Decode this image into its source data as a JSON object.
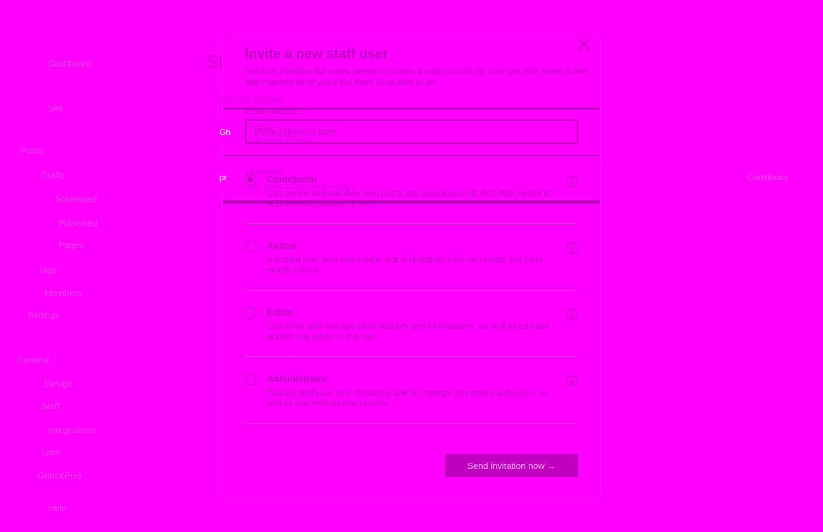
{
  "background": {
    "sidebar_items": [
      "Dashboard",
      "Site",
      "Posts",
      "Drafts",
      "Scheduled",
      "Published",
      "Pages",
      "Tags",
      "Members",
      "Settings",
      "General",
      "Design",
      "Staff",
      "Integrations",
      "Labs",
      "Ghost(Pro)",
      "Help"
    ],
    "page_title": "Staff users",
    "section_label": "ACTIVE USERS",
    "users": [
      {
        "initials": "Gh",
        "name": "Ghost",
        "last_seen": "Last seen: (Never)"
      },
      {
        "initials": "pr",
        "name": "pruebas",
        "last_seen": "Last seen: a few seconds ago"
      }
    ],
    "right_label": "Contributor"
  },
  "modal": {
    "title": "Invite a new staff user",
    "subtitle": "Send an invitation for a new person to create a staff account on your site, and select a role that matches what you'd like them to be able to do.",
    "email_label": "Email address",
    "email_value": "invite3@ghost.com",
    "roles": [
      {
        "name": "Contributor",
        "description": "Can create and edit their own posts, but cannot publish. An Editor needs to approve and publish for them.",
        "checked": true
      },
      {
        "name": "Author",
        "description": "A trusted user who can create, edit and publish their own posts, but can't modify others.",
        "checked": false
      },
      {
        "name": "Editor",
        "description": "Can invite and manage other Authors and Contributors, as well as edit and publish any posts on the site.",
        "checked": false
      },
      {
        "name": "Administrator",
        "description": "Trusted staff user who should be able to manage all content and users, as well as site settings and options.",
        "checked": false
      }
    ],
    "send_button": "Send invitation now →"
  },
  "icons": {
    "close": "close-icon",
    "info": "info-icon"
  },
  "colors": {
    "background": "#ff00ff",
    "accent": "#c000c0"
  }
}
